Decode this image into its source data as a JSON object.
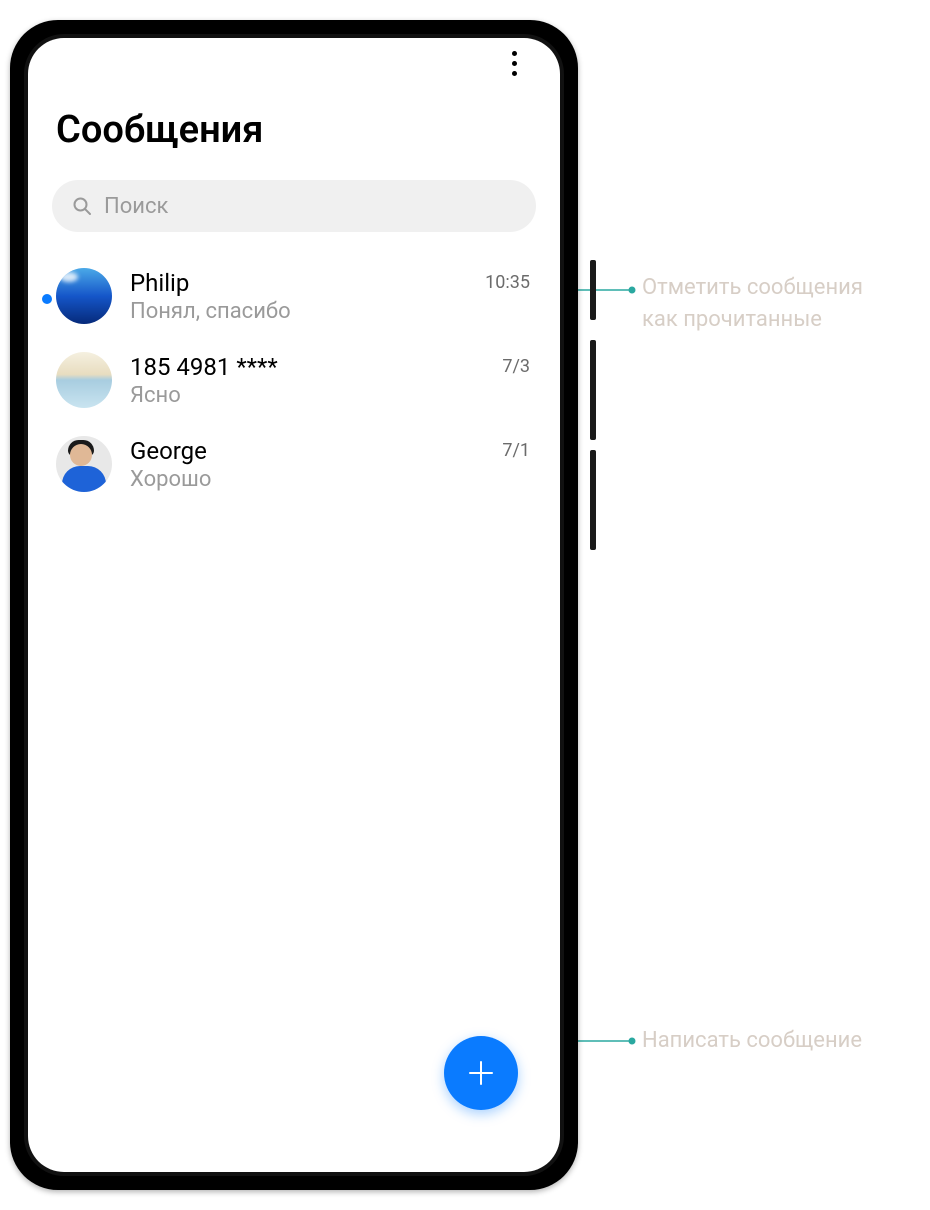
{
  "header": {
    "title": "Сообщения"
  },
  "search": {
    "placeholder": "Поиск"
  },
  "conversations": [
    {
      "name": "Philip",
      "preview": "Понял, спасибо",
      "time": "10:35",
      "unread": true
    },
    {
      "name": "185 4981 ****",
      "preview": "Ясно",
      "time": "7/3",
      "unread": false
    },
    {
      "name": "George",
      "preview": "Хорошо",
      "time": "7/1",
      "unread": false
    }
  ],
  "callouts": {
    "mark_read": "Отметить сообщения как прочитанные",
    "compose": "Написать сообщение"
  },
  "colors": {
    "accent": "#0a7bff",
    "callout_line": "#2aa8a0",
    "callout_text": "#d7cec6"
  }
}
